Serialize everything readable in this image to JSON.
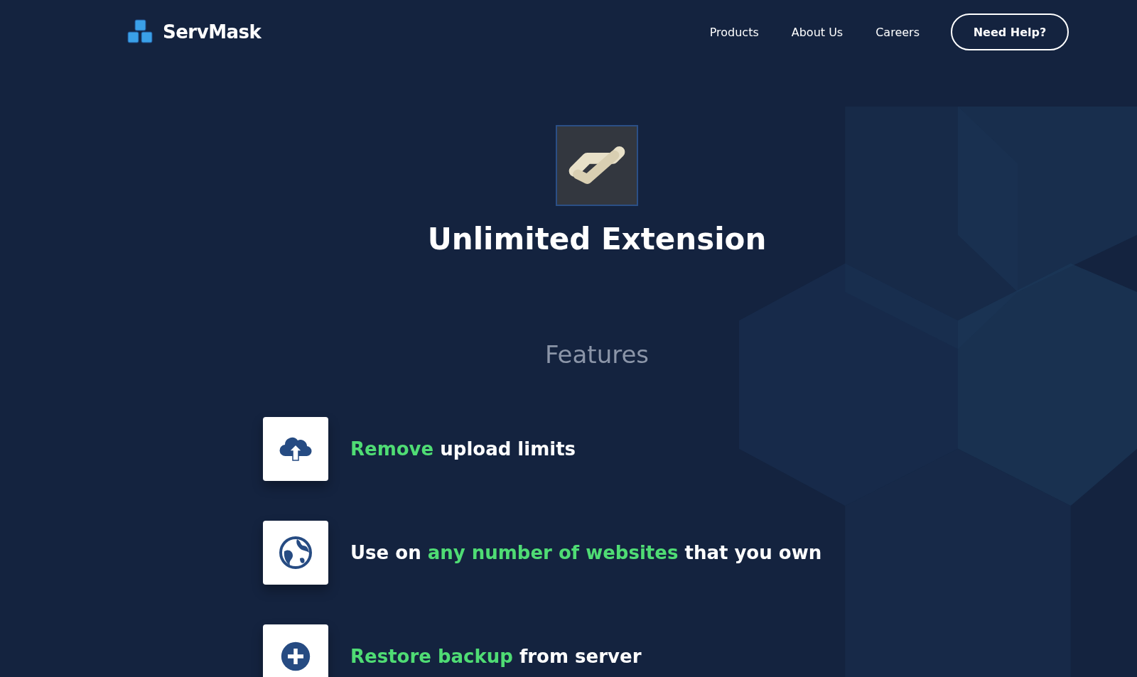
{
  "header": {
    "brand": "ServMask",
    "nav": [
      "Products",
      "About Us",
      "Careers"
    ],
    "help_button": "Need Help?"
  },
  "product": {
    "title": "Unlimited Extension"
  },
  "features_heading": "Features",
  "features": [
    {
      "kind": "upload",
      "parts": [
        {
          "text": "Remove",
          "highlight": true
        },
        {
          "text": " upload limits",
          "highlight": false
        }
      ]
    },
    {
      "kind": "globe",
      "parts": [
        {
          "text": "Use on ",
          "highlight": false
        },
        {
          "text": "any number of websites",
          "highlight": true
        },
        {
          "text": " that you own",
          "highlight": false
        }
      ]
    },
    {
      "kind": "plus",
      "parts": [
        {
          "text": "Restore backup",
          "highlight": true
        },
        {
          "text": " from server",
          "highlight": false
        }
      ]
    }
  ]
}
